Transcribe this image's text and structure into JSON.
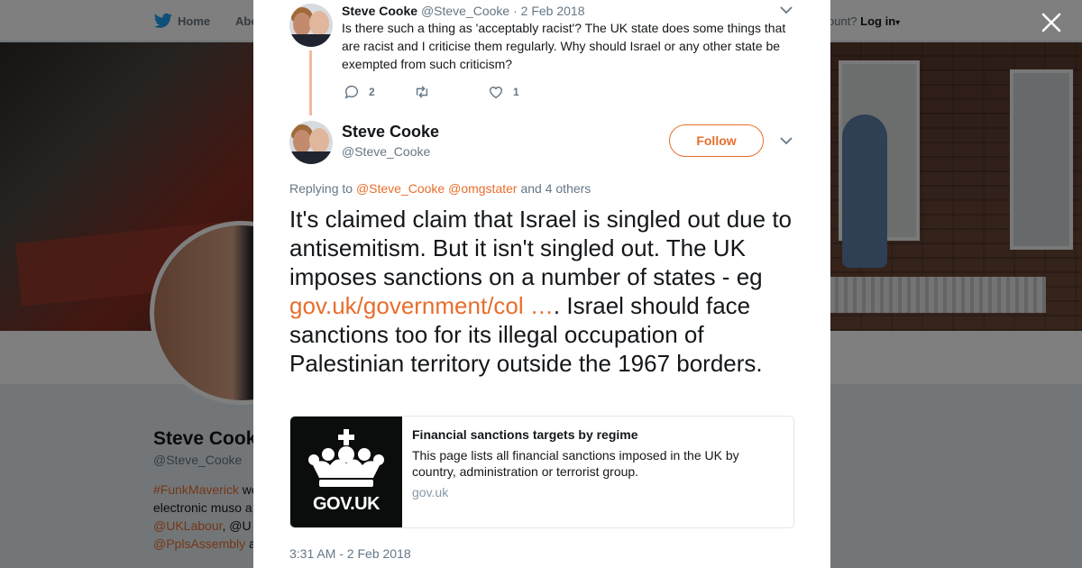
{
  "nav": {
    "home_label": "Home",
    "about_label": "Abo",
    "have_account_text": "ccount?",
    "login_label": "Log in"
  },
  "profile": {
    "name": "Steve Cook",
    "handle": "@Steve_Cooke",
    "bio_lines": [
      {
        "link": "#FunkMaverick",
        "text": " we"
      },
      {
        "link": "",
        "text": "electronic muso a"
      },
      {
        "link": "@UKLabour",
        "text": ", @U"
      },
      {
        "link": "@PplsAssembly",
        "text": " a"
      }
    ]
  },
  "parent_tweet": {
    "name": "Steve Cooke",
    "handle": "@Steve_Cooke",
    "separator": " · ",
    "date": "2 Feb 2018",
    "text": "Is there such a thing as 'acceptably racist'? The UK state does some things that are racist and I criticise them regularly. Why should Israel or any other state be exempted from such criticism?",
    "reply_count": "2",
    "retweet_count": "",
    "like_count": "1"
  },
  "main_tweet": {
    "name": "Steve Cooke",
    "handle": "@Steve_Cooke",
    "follow_label": "Follow",
    "replying_prefix": "Replying to ",
    "replying_mention_1": "@Steve_Cooke",
    "replying_mention_2": "@omgstater",
    "replying_suffix": " and 4 others",
    "text_before_link": "It's claimed claim that Israel is singled out due to antisemitism. But it isn't singled out. The UK imposes sanctions on a number of states - eg ",
    "link_text": "gov.uk/government/col",
    "link_ellipsis": "…",
    "text_after_link": ". Israel should face sanctions too for its illegal occupation of Palestinian territory outside the 1967 borders.",
    "timestamp": "3:31 AM - 2 Feb 2018"
  },
  "card": {
    "logo_text": "GOV.UK",
    "title": "Financial sanctions targets by regime",
    "description": "This page lists all financial sanctions imposed in the UK by country, administration or terrorist group.",
    "domain": "gov.uk"
  },
  "icons": {
    "logo": "twitter-bird-icon",
    "close": "close-icon",
    "reply": "reply-icon",
    "retweet": "retweet-icon",
    "like": "heart-icon",
    "caret": "chevron-down-icon"
  },
  "colors": {
    "accent": "#e86e2c",
    "twitter_blue": "#1da1f2",
    "text_primary": "#14171a",
    "text_secondary": "#657786",
    "thread_line": "#f7b89a"
  }
}
